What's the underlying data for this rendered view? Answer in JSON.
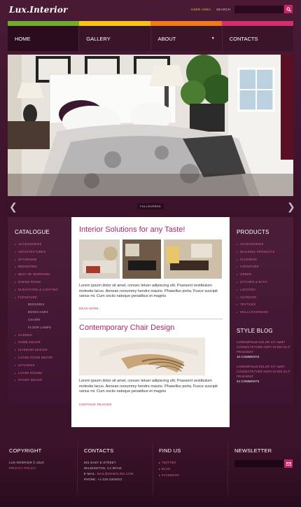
{
  "header": {
    "logo": "Lux.Interior",
    "user_area": "USER AREA",
    "search_label": "SEARCH",
    "search_value": ""
  },
  "colors": {
    "bar": [
      "#6eac2a",
      "#f6c316",
      "#ef7a1a",
      "#d62c70"
    ],
    "accent": "#c9236b"
  },
  "nav": [
    {
      "label": "HOME"
    },
    {
      "label": "GALLERY"
    },
    {
      "label": "ABOUT"
    },
    {
      "label": "CONTACTS"
    }
  ],
  "hero": {
    "fullscreen_label": "FULLSCREEN"
  },
  "catalogue": {
    "title": "CATALOGUE",
    "items": [
      {
        "label": "ACCESSORIES",
        "sub": false
      },
      {
        "label": "ARCHITECTURES",
        "sub": false
      },
      {
        "label": "BATHROOM",
        "sub": false
      },
      {
        "label": "BEDROOMS",
        "sub": false
      },
      {
        "label": "BEST OF BORROMO",
        "sub": false
      },
      {
        "label": "DINING ROOM",
        "sub": false
      },
      {
        "label": "ELEVATIONS & LIGHTING",
        "sub": false
      },
      {
        "label": "FURNITURE",
        "sub": false
      },
      {
        "label": "BEDSIDES",
        "sub": true
      },
      {
        "label": "BOOKCASES",
        "sub": true
      },
      {
        "label": "CHAIRS",
        "sub": true
      },
      {
        "label": "FLOOR LAMPS",
        "sub": true
      },
      {
        "label": "GARDEN",
        "sub": false
      },
      {
        "label": "HOME DECOR",
        "sub": false
      },
      {
        "label": "INTERIOR DESIGN",
        "sub": false
      },
      {
        "label": "LIVING ROOM DECOR",
        "sub": false
      },
      {
        "label": "KITCHENS",
        "sub": false
      },
      {
        "label": "LIVING ROOMS",
        "sub": false
      },
      {
        "label": "OTHER DECOR",
        "sub": false
      }
    ]
  },
  "products": {
    "title": "PRODUCTS",
    "items": [
      {
        "label": "ACCESSORIES"
      },
      {
        "label": "BUILDING PRODUCTS"
      },
      {
        "label": "FLOORING"
      },
      {
        "label": "FURNITURE"
      },
      {
        "label": "GREEN"
      },
      {
        "label": "KITCHEN & BATH"
      },
      {
        "label": "LIGHTING"
      },
      {
        "label": "OUTDOOR"
      },
      {
        "label": "TEXTILES"
      },
      {
        "label": "WALLCOVERINGS"
      }
    ]
  },
  "style_blog": {
    "title": "STYLE BLOG",
    "entries": [
      {
        "text": "LOREMIPSUM DOLOR SIT AMET CONSECTETUER ADIPI SCING ELIT PRAESENT",
        "count": "10 COMMENTS"
      },
      {
        "text": "LOREMIPSUM DOLOR SIT AMET CONSECTETUER ADIPI SCING ELIT PRAESENT",
        "count": "24 COMMENTS"
      }
    ]
  },
  "posts": [
    {
      "title": "Interior Solutions for any Taste!",
      "text": "Lorem ipsum dolor sit amet, consec tetuer adipiscing elit. Praesent vestibulum molestie lacus. Aenean nonummy hendre mauris. Phasellus porta. Fusce suscipit varius mi. Cum sociis natoque penatibus et magnis",
      "more": "READ MORE"
    },
    {
      "title": "Contemporary Chair Design",
      "text": "Lorem ipsum dolor sit amet, consec tetuer adipiscing elit. Praesent vestibulum molestie lacus. Aenean nonummy hendre mauris. Phasellus porta. Fusce suscipit varius mi. Cum sociis natoque penatibus et magnis",
      "more": "CONTINUE READING"
    }
  ],
  "footer": {
    "copyright": {
      "title": "COPYRIGHT",
      "line": "LUX INTERIOR © 2010",
      "policy": "PRIVACY POLICY"
    },
    "contacts": {
      "title": "CONTACTS",
      "lines": [
        "901 EAST E STREET",
        "WILMINGTON, CA 90744"
      ],
      "email_prefix": "E-MAIL:",
      "email": "MAIL@DEMOLINK.COM",
      "phone": "PHONE: +1-310-3304022"
    },
    "find_us": {
      "title": "FIND US",
      "links": [
        "TWITTER",
        "BLOG",
        "FACEBOOK"
      ]
    },
    "newsletter": {
      "title": "NEWSLETTER",
      "value": ""
    }
  }
}
